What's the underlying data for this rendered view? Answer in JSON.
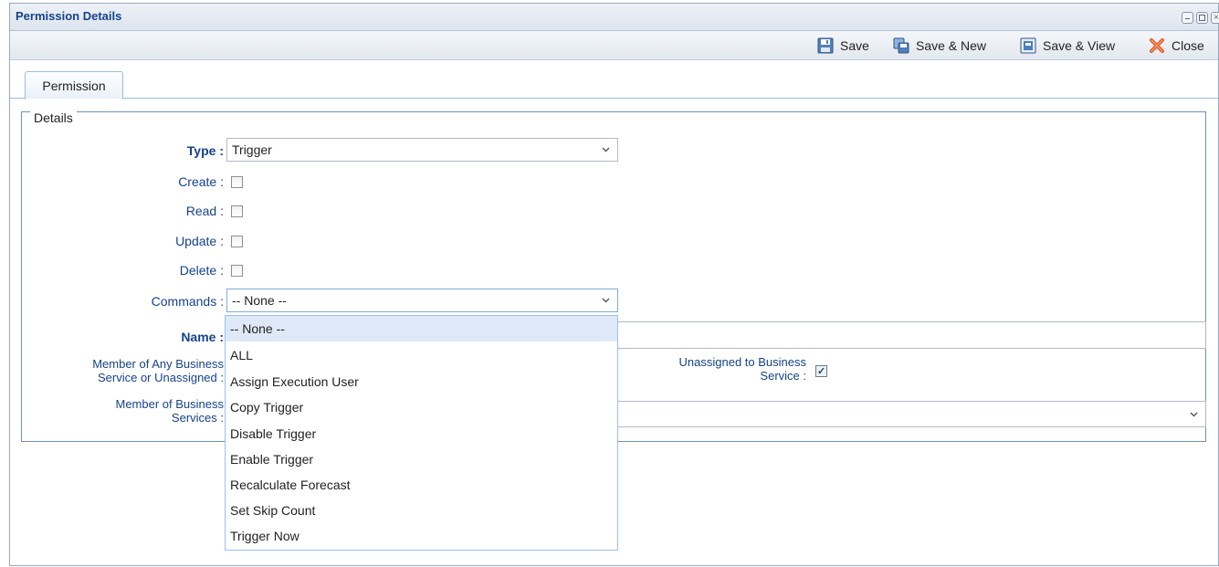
{
  "window": {
    "title": "Permission Details"
  },
  "toolbar": {
    "save_label": "Save",
    "save_new_label": "Save & New",
    "save_view_label": "Save & View",
    "close_label": "Close"
  },
  "tabs": [
    {
      "label": "Permission",
      "active": true
    }
  ],
  "details": {
    "legend": "Details",
    "type_label": "Type :",
    "type_value": "Trigger",
    "create_label": "Create :",
    "create_checked": false,
    "read_label": "Read :",
    "read_checked": false,
    "update_label": "Update :",
    "update_checked": false,
    "delete_label": "Delete :",
    "delete_checked": false,
    "commands_label": "Commands :",
    "commands_value": "-- None --",
    "name_label": "Name :",
    "name_value": "",
    "member_any_label_line1": "Member of Any Business",
    "member_any_label_line2": "Service or Unassigned :",
    "unassigned_label_line1": "Unassigned to Business",
    "unassigned_label_line2": "Service :",
    "unassigned_checked": true,
    "member_services_label_line1": "Member of Business",
    "member_services_label_line2": "Services :"
  },
  "commands_dropdown": {
    "options": [
      "-- None --",
      "ALL",
      "Assign Execution User",
      "Copy Trigger",
      "Disable Trigger",
      "Enable Trigger",
      "Recalculate Forecast",
      "Set Skip Count",
      "Trigger Now"
    ],
    "selected": "-- None --"
  },
  "colors": {
    "title_text": "#15428b",
    "label_text": "#15428b",
    "fieldset_border": "#6b91c0",
    "dropdown_selected_bg": "#dfe8f6",
    "close_icon": "#e05a2a"
  },
  "icons": {
    "save": "floppy-disk-icon",
    "save_new": "save-new-icon",
    "save_view": "save-view-icon",
    "close": "red-x-icon",
    "select": "chevron-down-icon"
  }
}
